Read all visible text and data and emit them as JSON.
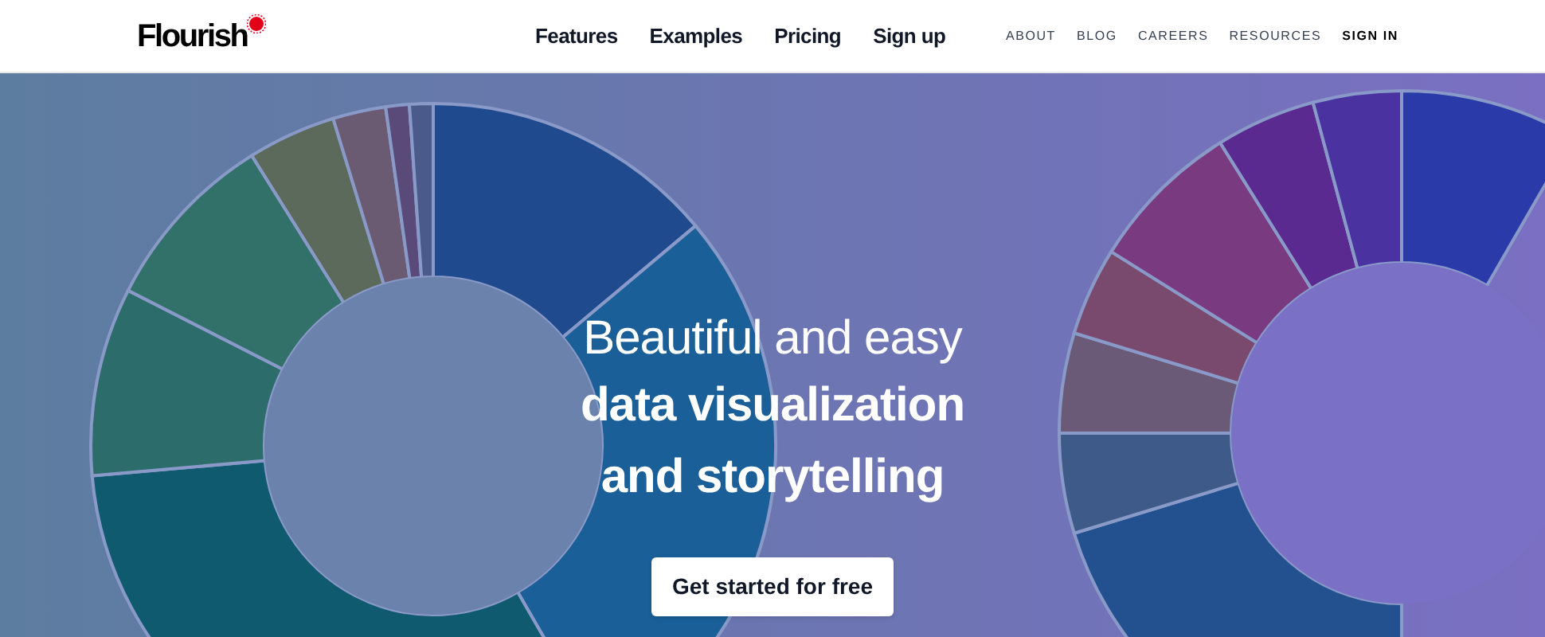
{
  "header": {
    "logo": "Flourish",
    "nav": [
      "Features",
      "Examples",
      "Pricing",
      "Sign up"
    ],
    "secondary_nav": [
      "ABOUT",
      "BLOG",
      "CAREERS",
      "RESOURCES",
      "SIGN IN"
    ]
  },
  "hero": {
    "title_light": "Beautiful and easy",
    "title_bold": [
      "data visualization",
      "and storytelling"
    ],
    "button": "Get started for free"
  }
}
